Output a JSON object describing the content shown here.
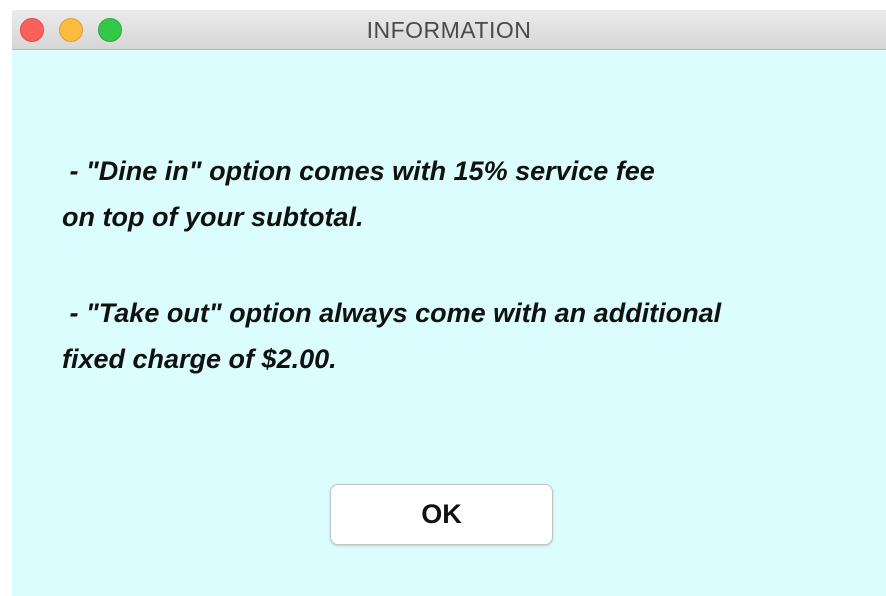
{
  "window": {
    "title": "INFORMATION",
    "background_color": "#dcfdfe"
  },
  "titlebar": {
    "buttons": {
      "close": {
        "icon": "close-traffic-light-icon",
        "color": "#fc605c"
      },
      "minimize": {
        "icon": "minimize-traffic-light-icon",
        "color": "#fdbc40"
      },
      "maximize": {
        "icon": "zoom-traffic-light-icon",
        "color": "#34c84a"
      }
    }
  },
  "message": {
    "dine_in_line1": " - \"Dine in\" option comes with 15% service fee",
    "dine_in_line2": "on top of your subtotal.",
    "take_out_line1": " - \"Take out\" option always come with an additional",
    "take_out_line2": "fixed charge of $2.00."
  },
  "actions": {
    "ok_label": "OK"
  }
}
